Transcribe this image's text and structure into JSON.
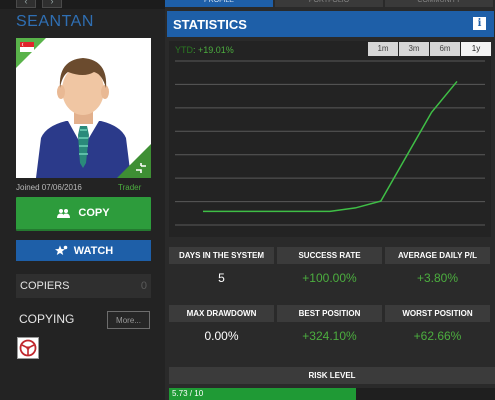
{
  "profile": {
    "username": "SEANTAN",
    "joined": "Joined 07/06/2016",
    "role": "Trader",
    "copy_label": "COPY",
    "watch_label": "WATCH",
    "copiers_label": "COPIERS",
    "copiers_count": "0",
    "copying_label": "COPYING",
    "more_label": "More..."
  },
  "tabs": [
    {
      "label": "PROFILE"
    },
    {
      "label": "PORTFOLIO"
    },
    {
      "label": "COMMUNITY"
    }
  ],
  "statistics": {
    "title": "STATISTICS",
    "ytd_key": "YTD",
    "ytd_value": "+19.01%",
    "ranges": [
      "1m",
      "3m",
      "6m",
      "1y"
    ],
    "active_range": "1y"
  },
  "chart_data": {
    "type": "line",
    "title": "",
    "xlabel": "",
    "ylabel": "",
    "grid": true,
    "series": [
      {
        "values": [
          0.0,
          0.0,
          0.0,
          0.0,
          0.0,
          0.0,
          0.5,
          1.5,
          8.0,
          14.5,
          19.01
        ]
      }
    ],
    "x": [
      0,
      1,
      2,
      3,
      4,
      5,
      6,
      7,
      8,
      9,
      10
    ],
    "ylim": [
      -2,
      22
    ],
    "line_color": "#3fbf46"
  },
  "stats": {
    "days_label": "DAYS IN THE SYSTEM",
    "days_value": "5",
    "success_label": "SUCCESS RATE",
    "success_value": "+100.00%",
    "avg_label": "AVERAGE DAILY P/L",
    "avg_value": "+3.80%",
    "drawdown_label": "MAX DRAWDOWN",
    "drawdown_value": "0.00%",
    "best_label": "BEST POSITION",
    "best_value": "+324.10%",
    "worst_label": "WORST POSITION",
    "worst_value": "+62.66%"
  },
  "risk": {
    "label": "RISK LEVEL",
    "value_text": "5.73 / 10",
    "fraction": 0.573
  }
}
